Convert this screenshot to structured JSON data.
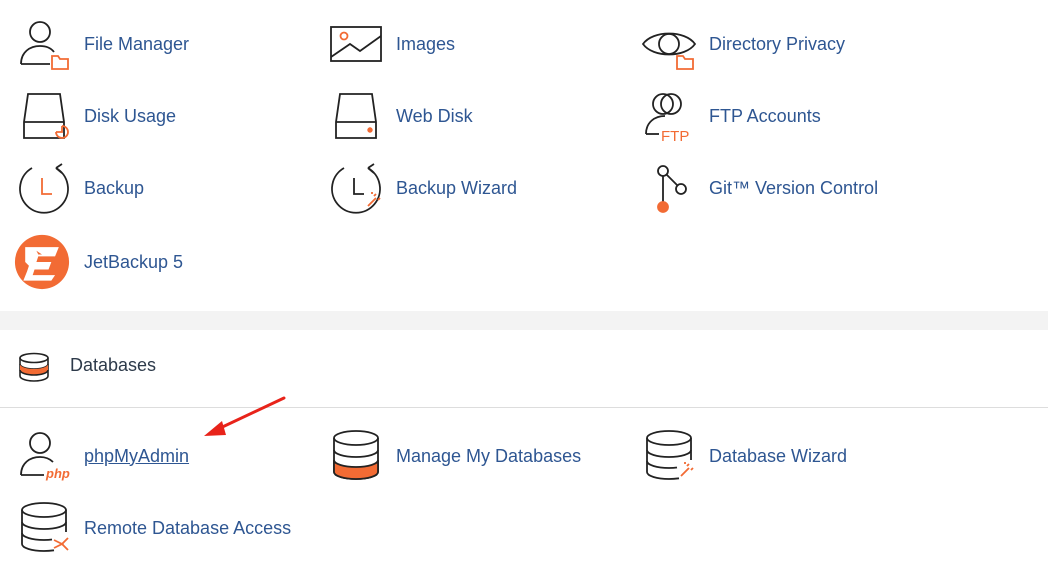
{
  "files": {
    "items": [
      {
        "label": "File Manager",
        "icon": "file-manager-icon"
      },
      {
        "label": "Images",
        "icon": "images-icon"
      },
      {
        "label": "Directory Privacy",
        "icon": "directory-privacy-icon"
      },
      {
        "label": "Disk Usage",
        "icon": "disk-usage-icon"
      },
      {
        "label": "Web Disk",
        "icon": "web-disk-icon"
      },
      {
        "label": "FTP Accounts",
        "icon": "ftp-accounts-icon"
      },
      {
        "label": "Backup",
        "icon": "backup-icon"
      },
      {
        "label": "Backup Wizard",
        "icon": "backup-wizard-icon"
      },
      {
        "label": "Git™ Version Control",
        "icon": "git-version-control-icon"
      },
      {
        "label": "JetBackup 5",
        "icon": "jetbackup-icon"
      }
    ],
    "icon_text": {
      "ftp": "FTP"
    }
  },
  "databases": {
    "title": "Databases",
    "items": [
      {
        "label": "phpMyAdmin",
        "icon": "phpmyadmin-icon"
      },
      {
        "label": "Manage My Databases",
        "icon": "manage-databases-icon"
      },
      {
        "label": "Database Wizard",
        "icon": "database-wizard-icon"
      },
      {
        "label": "Remote Database Access",
        "icon": "remote-database-icon"
      }
    ],
    "icon_text": {
      "php": "php"
    }
  },
  "colors": {
    "link": "#2e5692",
    "accent": "#f26b34",
    "annotation": "#e8231a"
  }
}
